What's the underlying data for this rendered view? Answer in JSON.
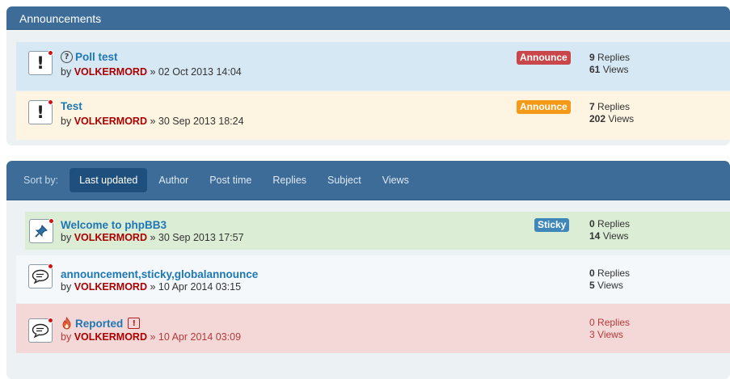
{
  "announcements": {
    "header_title": "Announcements",
    "rows": [
      {
        "title": "Poll test",
        "by": "by",
        "author": "VOLKERMORD",
        "sep": "»",
        "date": "02 Oct 2013 14:04",
        "badge": "Announce",
        "replies_count": "9",
        "replies_label": "Replies",
        "views_count": "61",
        "views_label": "Views"
      },
      {
        "title": "Test",
        "by": "by",
        "author": "VOLKERMORD",
        "sep": "»",
        "date": "30 Sep 2013 18:24",
        "badge": "Announce",
        "replies_count": "7",
        "replies_label": "Replies",
        "views_count": "202",
        "views_label": "Views"
      }
    ]
  },
  "sort": {
    "label": "Sort by:",
    "items": [
      "Last updated",
      "Author",
      "Post time",
      "Replies",
      "Subject",
      "Views"
    ],
    "active": "Last updated"
  },
  "topics": {
    "rows": [
      {
        "title": "Welcome to phpBB3",
        "by": "by",
        "author": "VOLKERMORD",
        "sep": "»",
        "date": "30 Sep 2013 17:57",
        "badge": "Sticky",
        "replies_count": "0",
        "replies_label": "Replies",
        "views_count": "14",
        "views_label": "Views"
      },
      {
        "title": "announcement,sticky,globalannounce",
        "by": "by",
        "author": "VOLKERMORD",
        "sep": "»",
        "date": "10 Apr 2014 03:15",
        "replies_count": "0",
        "replies_label": "Replies",
        "views_count": "5",
        "views_label": "Views"
      },
      {
        "title": "Reported",
        "by": "by",
        "author": "VOLKERMORD",
        "sep": "»",
        "date": "10 Apr 2014 03:09",
        "replies_count": "0",
        "replies_label": "Replies",
        "views_count": "3",
        "views_label": "Views"
      }
    ]
  },
  "colors": {
    "header_bg": "#3d6c98",
    "announce_red": "#c9464a",
    "announce_orange": "#f49a18",
    "sticky_blue": "#3f87b8",
    "author": "#aa0000",
    "link": "#1e77b5",
    "row_blue": "#d6e8f4",
    "row_yellow": "#fdf5e1",
    "row_green": "#dcedd5",
    "row_white": "#f4f8fb",
    "row_reported": "#f4d8d8"
  },
  "icons": {
    "announce_topic": "announce-icon",
    "poll": "question-circle-icon",
    "sticky_topic": "pushpin-icon",
    "normal_topic": "speech-bubble-icon",
    "reported_topic": "speech-bubble-icon",
    "hot": "fire-icon",
    "report_flag": "exclamation-box-icon"
  }
}
